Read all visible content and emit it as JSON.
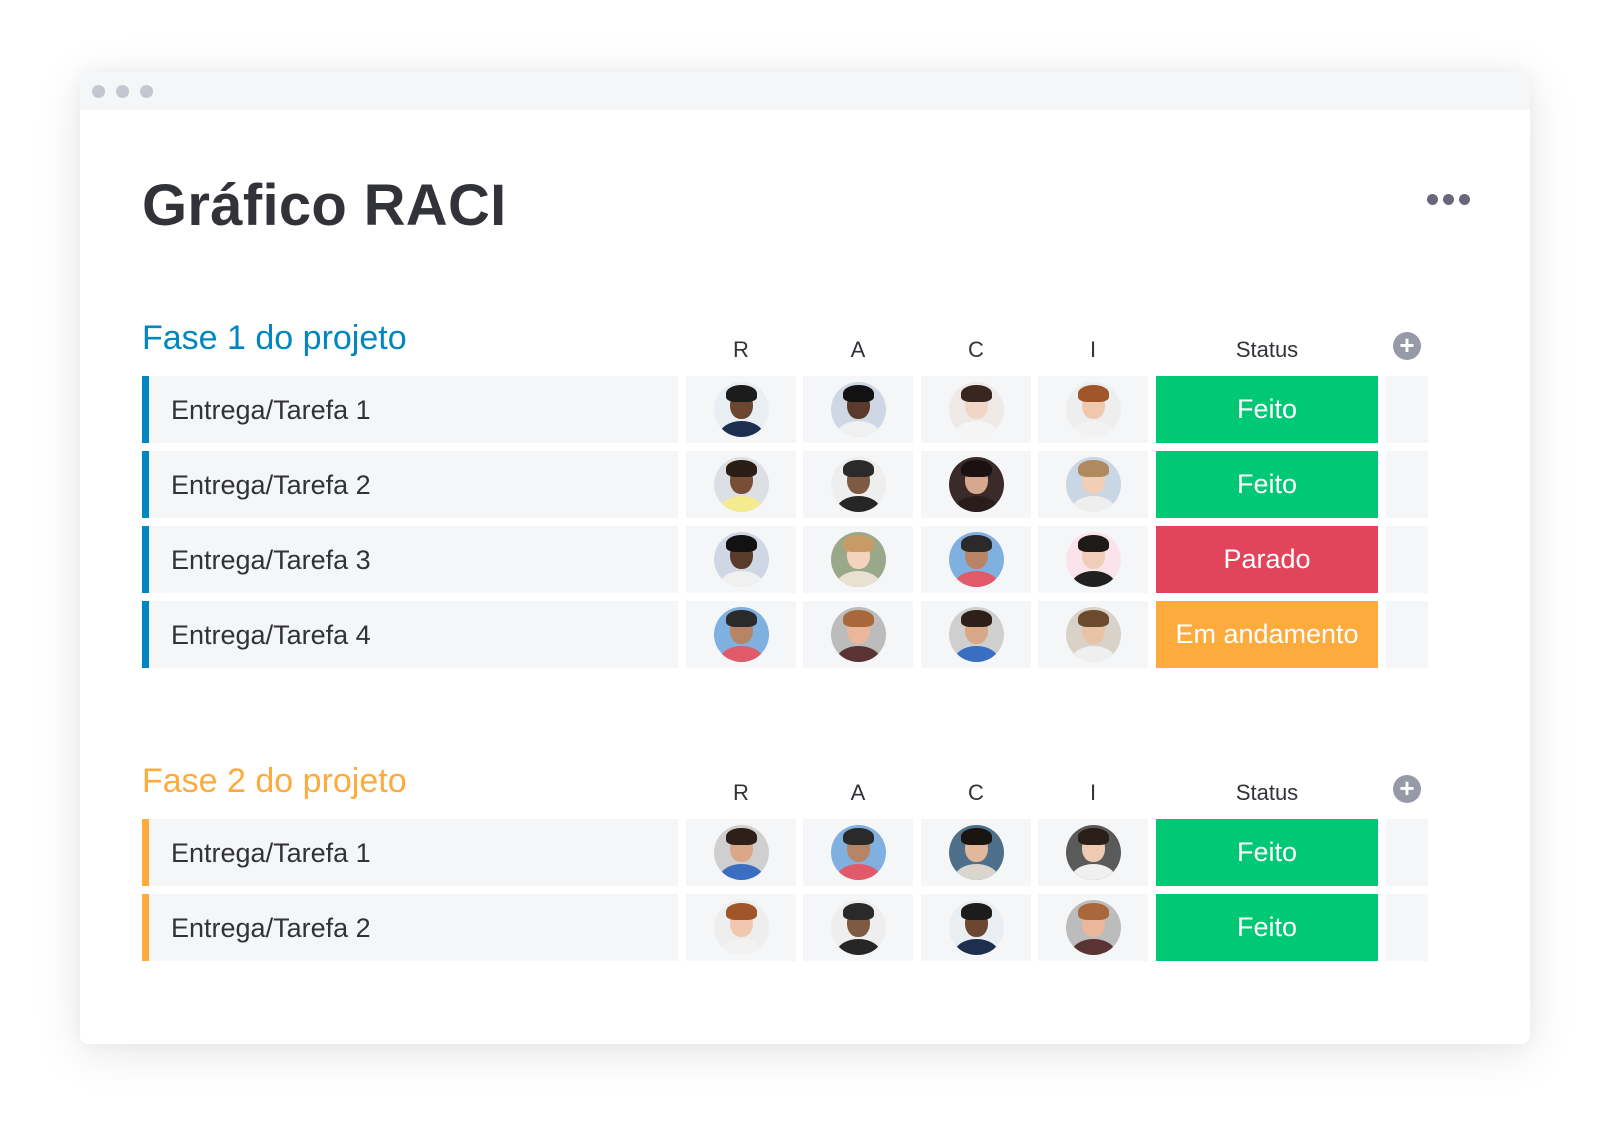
{
  "page": {
    "title": "Gráfico RACI"
  },
  "columns": {
    "r": "R",
    "a": "A",
    "c": "C",
    "i": "I",
    "status": "Status"
  },
  "colors": {
    "phase1": "#0086c0",
    "phase2": "#fdab3d",
    "done": "#00c875",
    "stuck": "#e2445c",
    "working": "#fdab3d",
    "cell_bg": "#f5f6f8"
  },
  "groups": [
    {
      "title": "Fase 1 do projeto",
      "color": "#0086c0",
      "rows": [
        {
          "name": "Entrega/Tarefa 1",
          "status": "Feito",
          "status_color": "#00c875",
          "people": [
            {
              "bg": "#e9eef3",
              "skin": "#6b4631",
              "hair": "#1c1c1c",
              "shirt": "#1d2f4f"
            },
            {
              "bg": "#cfd6e4",
              "skin": "#5a3a2a",
              "hair": "#121212",
              "shirt": "#f0f0f0"
            },
            {
              "bg": "#efeae8",
              "skin": "#f1d6c8",
              "hair": "#3a2620",
              "shirt": "#f5f5f5"
            },
            {
              "bg": "#eeeeee",
              "skin": "#f0c8ae",
              "hair": "#a0552a",
              "shirt": "#f2f2f2"
            }
          ]
        },
        {
          "name": "Entrega/Tarefa 2",
          "status": "Feito",
          "status_color": "#00c875",
          "people": [
            {
              "bg": "#dcdfe4",
              "skin": "#7a4e35",
              "hair": "#2a1d14",
              "shirt": "#f4ea8e"
            },
            {
              "bg": "#eeeeee",
              "skin": "#7e5a42",
              "hair": "#2a2a2a",
              "shirt": "#262626"
            },
            {
              "bg": "#3a2a2a",
              "skin": "#d8a88e",
              "hair": "#1a1212",
              "shirt": "#2b1c1c"
            },
            {
              "bg": "#c9d6e3",
              "skin": "#f0cfb6",
              "hair": "#b08a5e",
              "shirt": "#eeeeee"
            }
          ]
        },
        {
          "name": "Entrega/Tarefa 3",
          "status": "Parado",
          "status_color": "#e2445c",
          "people": [
            {
              "bg": "#cfd6e4",
              "skin": "#5a3a2a",
              "hair": "#121212",
              "shirt": "#f0f0f0"
            },
            {
              "bg": "#9aa88a",
              "skin": "#f3d3bd",
              "hair": "#c79b63",
              "shirt": "#e8e0d0"
            },
            {
              "bg": "#7fb0e0",
              "skin": "#b88466",
              "hair": "#2a2a2a",
              "shirt": "#e05a6a"
            },
            {
              "bg": "#fbe3ec",
              "skin": "#f0cdb9",
              "hair": "#1e1a18",
              "shirt": "#202020"
            }
          ]
        },
        {
          "name": "Entrega/Tarefa 4",
          "status": "Em andamento",
          "status_color": "#fdab3d",
          "people": [
            {
              "bg": "#7fb0e0",
              "skin": "#b88466",
              "hair": "#2a2a2a",
              "shirt": "#e05a6a"
            },
            {
              "bg": "#bcbcbc",
              "skin": "#eab79a",
              "hair": "#a8683c",
              "shirt": "#5a3434"
            },
            {
              "bg": "#cfcfcf",
              "skin": "#d9a888",
              "hair": "#2e2018",
              "shirt": "#3a6ec0"
            },
            {
              "bg": "#d8d2c8",
              "skin": "#e9c3a6",
              "hair": "#6b4a2e",
              "shirt": "#efefef"
            }
          ]
        }
      ]
    },
    {
      "title": "Fase 2 do projeto",
      "color": "#fdab3d",
      "rows": [
        {
          "name": "Entrega/Tarefa 1",
          "status": "Feito",
          "status_color": "#00c875",
          "people": [
            {
              "bg": "#cfcfcf",
              "skin": "#d9a888",
              "hair": "#2e2018",
              "shirt": "#3a6ec0"
            },
            {
              "bg": "#7fb0e0",
              "skin": "#b88466",
              "hair": "#2a2a2a",
              "shirt": "#e05a6a"
            },
            {
              "bg": "#4d6f8a",
              "skin": "#e3b79a",
              "hair": "#1a1411",
              "shirt": "#dad6cf"
            },
            {
              "bg": "#5a5a5a",
              "skin": "#efc9b2",
              "hair": "#2a1e18",
              "shirt": "#f0f0f0"
            }
          ]
        },
        {
          "name": "Entrega/Tarefa 2",
          "status": "Feito",
          "status_color": "#00c875",
          "people": [
            {
              "bg": "#eeeeee",
              "skin": "#f0c8ae",
              "hair": "#a0552a",
              "shirt": "#f2f2f2"
            },
            {
              "bg": "#eeeeee",
              "skin": "#7e5a42",
              "hair": "#2a2a2a",
              "shirt": "#262626"
            },
            {
              "bg": "#e9eef3",
              "skin": "#6b4631",
              "hair": "#1c1c1c",
              "shirt": "#1d2f4f"
            },
            {
              "bg": "#bcbcbc",
              "skin": "#eab79a",
              "hair": "#a8683c",
              "shirt": "#5a3434"
            }
          ]
        }
      ]
    }
  ]
}
